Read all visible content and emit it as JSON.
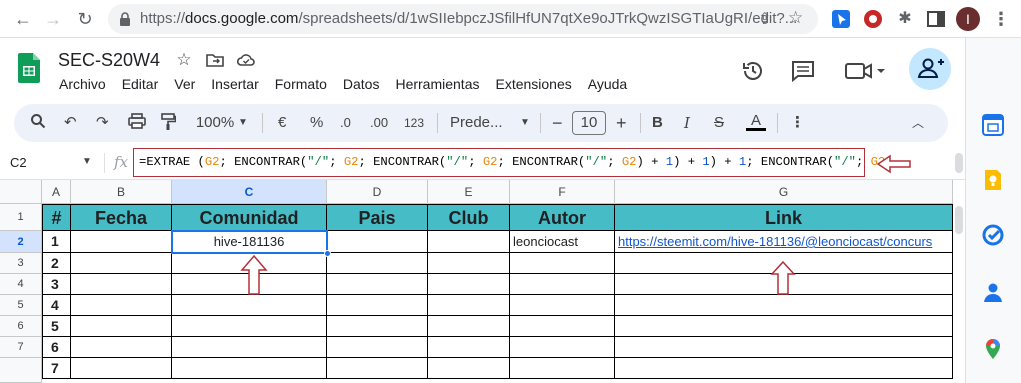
{
  "browser": {
    "url_host": "docs.google.com",
    "url_path": "/spreadsheets/d/1wSIIebpczJSfilHfUN7qtXe9oJTrkQwzISGTIaUgRI/edit?..."
  },
  "doc": {
    "title": "SEC-S20W4",
    "menu": [
      "Archivo",
      "Editar",
      "Ver",
      "Insertar",
      "Formato",
      "Datos",
      "Herramientas",
      "Extensiones",
      "Ayuda"
    ]
  },
  "toolbar": {
    "zoom": "100%",
    "currency": "€",
    "percent": "%",
    "dec_decrease": ".0",
    "dec_increase": ".00",
    "number_format": "123",
    "font": "Prede...",
    "font_size": "10"
  },
  "formula_bar": {
    "cell_ref": "C2",
    "fx": "fx",
    "formula": "=EXTRAE (G2; ENCONTRAR(\"/\"; G2; ENCONTRAR(\"/\"; G2; ENCONTRAR(\"/\"; G2) + 1) + 1) + 1; ENCONTRAR(\"/\"; G2;"
  },
  "grid": {
    "columns": [
      "A",
      "B",
      "C",
      "D",
      "E",
      "F",
      "G"
    ],
    "rows": [
      "1",
      "2",
      "3",
      "4",
      "5",
      "6",
      "7"
    ],
    "header_row": [
      "#",
      "Fecha",
      "Comunidad",
      "Pais",
      "Club",
      "Autor",
      "Link"
    ],
    "data_rows": [
      {
        "num": "1",
        "fecha": "",
        "comunidad": "hive-181136",
        "pais": "",
        "club": "",
        "autor": "leonciocast",
        "link": "https://steemit.com/hive-181136/@leonciocast/concurs"
      },
      {
        "num": "2"
      },
      {
        "num": "3"
      },
      {
        "num": "4"
      },
      {
        "num": "5"
      },
      {
        "num": "6"
      },
      {
        "num": "7"
      }
    ],
    "selected_cell": "C2"
  },
  "colors": {
    "header_fill": "#46bdc6",
    "annotation_red": "#b2303a",
    "selection_blue": "#1a73e8"
  }
}
